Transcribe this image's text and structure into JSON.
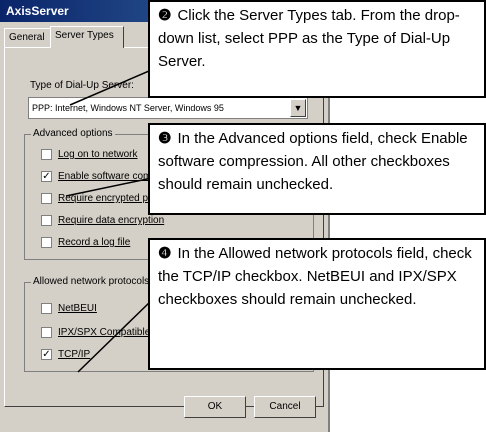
{
  "window": {
    "title": "AxisServer"
  },
  "tabs": [
    {
      "label": "General"
    },
    {
      "label": "Server Types"
    }
  ],
  "dialup": {
    "label": "Type of Dial-Up Server:",
    "value": "PPP: Internet, Windows NT Server, Windows 95"
  },
  "advanced": {
    "title": "Advanced options",
    "items": [
      {
        "label": "Log on to network",
        "checked": false
      },
      {
        "label": "Enable software compression",
        "checked": true
      },
      {
        "label": "Require encrypted password",
        "checked": false
      },
      {
        "label": "Require data encryption",
        "checked": false
      },
      {
        "label": "Record a log file",
        "checked": false
      }
    ]
  },
  "protocols": {
    "title": "Allowed network protocols",
    "items": [
      {
        "label": "NetBEUI",
        "checked": false
      },
      {
        "label": "IPX/SPX Compatible",
        "checked": false
      },
      {
        "label": "TCP/IP",
        "checked": true
      }
    ]
  },
  "buttons": {
    "ok": "OK",
    "cancel": "Cancel"
  },
  "callouts": [
    {
      "number": "❷",
      "text": "Click the Server Types tab. From the drop-down list, select PPP as the Type of Dial-Up Server."
    },
    {
      "number": "❸",
      "text": "In the Advanced options field, check Enable software compression. All other checkboxes should remain unchecked."
    },
    {
      "number": "❹",
      "text": "In the Allowed network protocols field, check the TCP/IP checkbox. NetBEUI and IPX/SPX checkboxes should remain unchecked."
    }
  ]
}
